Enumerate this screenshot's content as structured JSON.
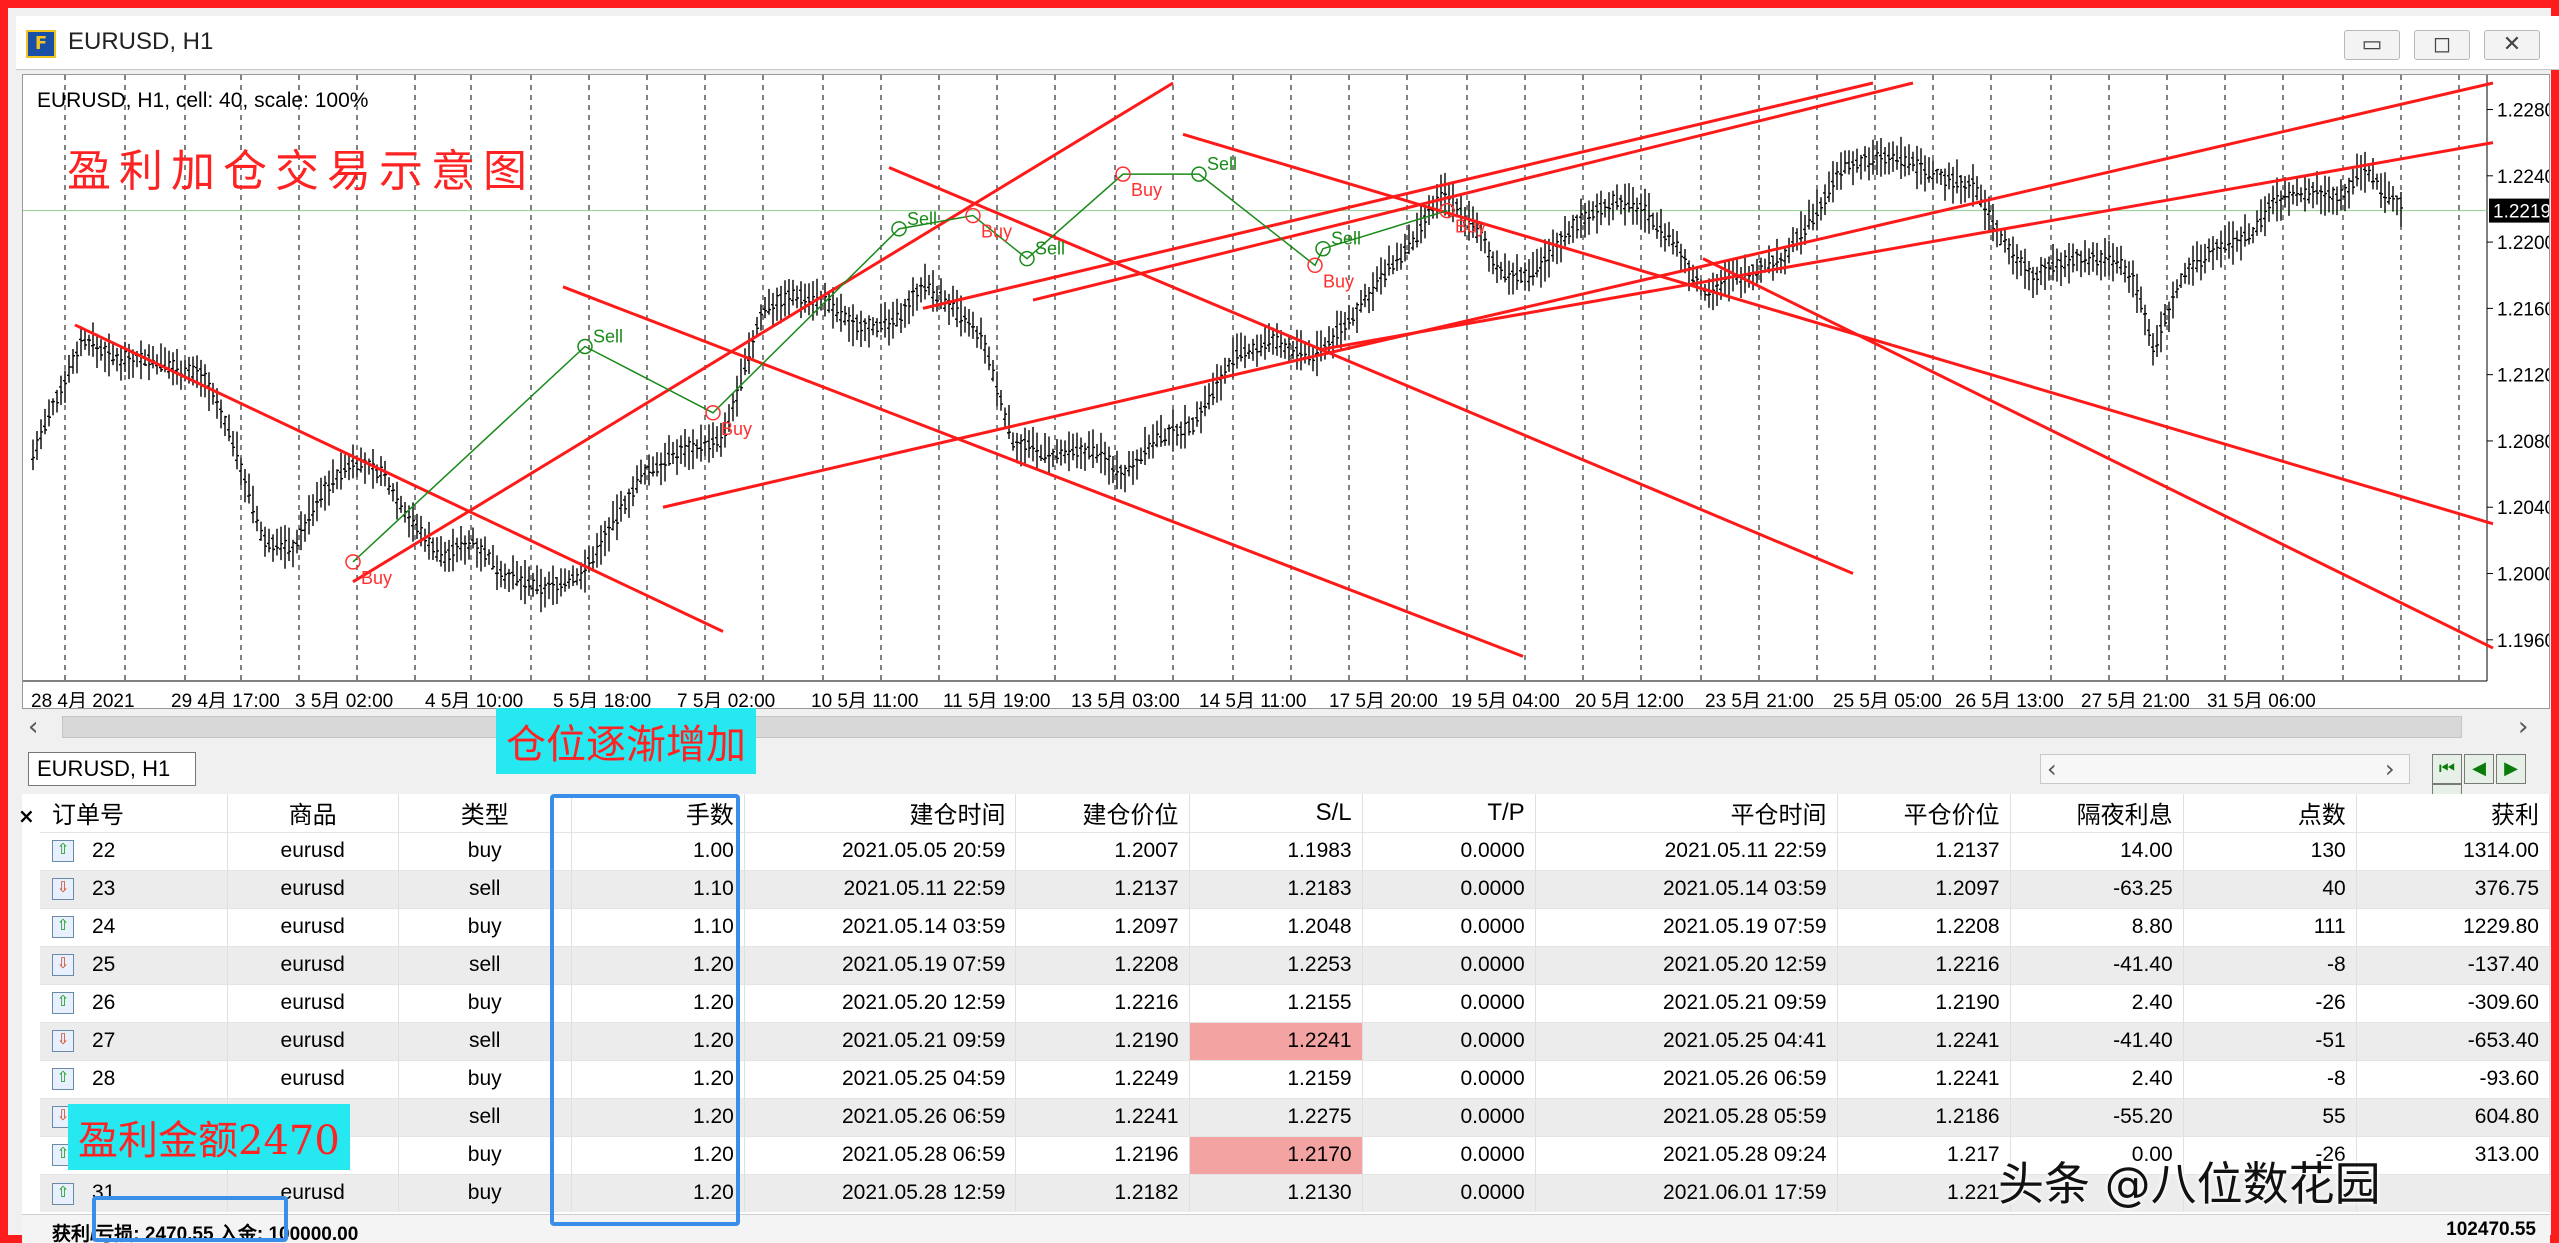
{
  "window": {
    "title": "EURUSD, H1",
    "icon": "metatrader-icon",
    "controls": [
      "minimize-icon",
      "maximize-icon",
      "close-icon"
    ]
  },
  "chart": {
    "info": "EURUSD, H1, cell: 40, scale: 100%",
    "annotation": "盈利加仓交易示意图",
    "current_price": "1.2219",
    "price_axis": [
      "1.2280",
      "1.2240",
      "1.2200",
      "1.2160",
      "1.2120",
      "1.2080",
      "1.2040",
      "1.2000",
      "1.1960"
    ],
    "time_axis": [
      "28 4月 2021",
      "29 4月 17:00",
      "3 5月 02:00",
      "4 5月 10:00",
      "5 5月 18:00",
      "7 5月 02:00",
      "10 5月 11:00",
      "11 5月 19:00",
      "13 5月 03:00",
      "14 5月 11:00",
      "17 5月 20:00",
      "19 5月 04:00",
      "20 5月 12:00",
      "23 5月 21:00",
      "25 5月 05:00",
      "26 5月 13:00",
      "27 5月 21:00",
      "31 5月 06:00"
    ],
    "trade_labels": [
      "Buy",
      "Sell",
      "Buy",
      "Sell",
      "Buy",
      "Sell",
      "Buy",
      "Sell",
      "Buy",
      "Sell",
      "Buy",
      "Sell"
    ]
  },
  "badges": {
    "position": "仓位逐渐增加",
    "profit": "盈利金额2470"
  },
  "symbol_tab": "EURUSD, H1",
  "orders": {
    "columns": [
      "订单号",
      "商品",
      "类型",
      "手数",
      "建仓时间",
      "建仓价位",
      "S/L",
      "T/P",
      "平仓时间",
      "平仓价位",
      "隔夜利息",
      "点数",
      "获利"
    ],
    "rows": [
      {
        "id": "22",
        "symbol": "eurusd",
        "type": "buy",
        "lots": "1.00",
        "open_time": "2021.05.05 20:59",
        "open_price": "1.2007",
        "sl": "1.1983",
        "tp": "0.0000",
        "close_time": "2021.05.11 22:59",
        "close_price": "1.2137",
        "swap": "14.00",
        "points": "130",
        "profit": "1314.00"
      },
      {
        "id": "23",
        "symbol": "eurusd",
        "type": "sell",
        "lots": "1.10",
        "open_time": "2021.05.11 22:59",
        "open_price": "1.2137",
        "sl": "1.2183",
        "tp": "0.0000",
        "close_time": "2021.05.14 03:59",
        "close_price": "1.2097",
        "swap": "-63.25",
        "points": "40",
        "profit": "376.75"
      },
      {
        "id": "24",
        "symbol": "eurusd",
        "type": "buy",
        "lots": "1.10",
        "open_time": "2021.05.14 03:59",
        "open_price": "1.2097",
        "sl": "1.2048",
        "tp": "0.0000",
        "close_time": "2021.05.19 07:59",
        "close_price": "1.2208",
        "swap": "8.80",
        "points": "111",
        "profit": "1229.80"
      },
      {
        "id": "25",
        "symbol": "eurusd",
        "type": "sell",
        "lots": "1.20",
        "open_time": "2021.05.19 07:59",
        "open_price": "1.2208",
        "sl": "1.2253",
        "tp": "0.0000",
        "close_time": "2021.05.20 12:59",
        "close_price": "1.2216",
        "swap": "-41.40",
        "points": "-8",
        "profit": "-137.40"
      },
      {
        "id": "26",
        "symbol": "eurusd",
        "type": "buy",
        "lots": "1.20",
        "open_time": "2021.05.20 12:59",
        "open_price": "1.2216",
        "sl": "1.2155",
        "tp": "0.0000",
        "close_time": "2021.05.21 09:59",
        "close_price": "1.2190",
        "swap": "2.40",
        "points": "-26",
        "profit": "-309.60"
      },
      {
        "id": "27",
        "symbol": "eurusd",
        "type": "sell",
        "lots": "1.20",
        "open_time": "2021.05.21 09:59",
        "open_price": "1.2190",
        "sl": "1.2241",
        "tp": "0.0000",
        "close_time": "2021.05.25 04:41",
        "close_price": "1.2241",
        "swap": "-41.40",
        "points": "-51",
        "profit": "-653.40",
        "sl_highlight": true
      },
      {
        "id": "28",
        "symbol": "eurusd",
        "type": "buy",
        "lots": "1.20",
        "open_time": "2021.05.25 04:59",
        "open_price": "1.2249",
        "sl": "1.2159",
        "tp": "0.0000",
        "close_time": "2021.05.26 06:59",
        "close_price": "1.2241",
        "swap": "2.40",
        "points": "-8",
        "profit": "-93.60"
      },
      {
        "id": "",
        "symbol": "",
        "type": "sell",
        "lots": "1.20",
        "open_time": "2021.05.26 06:59",
        "open_price": "1.2241",
        "sl": "1.2275",
        "tp": "0.0000",
        "close_time": "2021.05.28 05:59",
        "close_price": "1.2186",
        "swap": "-55.20",
        "points": "55",
        "profit": "604.80"
      },
      {
        "id": "",
        "symbol": "",
        "type": "buy",
        "lots": "1.20",
        "open_time": "2021.05.28 06:59",
        "open_price": "1.2196",
        "sl": "1.2170",
        "tp": "0.0000",
        "close_time": "2021.05.28 09:24",
        "close_price": "1.217",
        "swap": "0.00",
        "points": "-26",
        "profit": "313.00",
        "sl_highlight": true
      },
      {
        "id": "31",
        "symbol": "eurusd",
        "type": "buy",
        "lots": "1.20",
        "open_time": "2021.05.28 12:59",
        "open_price": "1.2182",
        "sl": "1.2130",
        "tp": "0.0000",
        "close_time": "2021.06.01 17:59",
        "close_price": "1.221",
        "swap": "",
        "points": "",
        "profit": ""
      }
    ]
  },
  "footer": {
    "left": "获利/亏损: 2470.55  入金: 100000.00",
    "right": "102470.55"
  },
  "watermark": "头条 @八位数花园",
  "colors": {
    "frame": "#ff1c1c",
    "channel_line": "#ff1a1a",
    "trend_line": "#1a8a1a",
    "sl_highlight": "#f4a3a3",
    "badge_bg": "#26e8f0",
    "box_blue": "#3a8ee8"
  }
}
